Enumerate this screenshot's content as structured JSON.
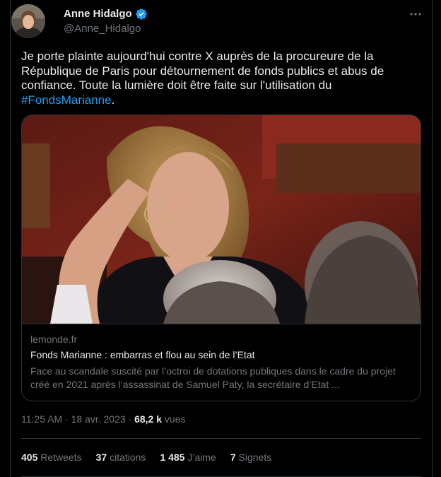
{
  "author": {
    "display_name": "Anne Hidalgo",
    "handle": "@Anne_Hidalgo",
    "verified": true,
    "verified_color": "#1d9bf0"
  },
  "tweet": {
    "text_before": "Je porte plainte aujourd'hui contre X auprès de la procureure de la République de Paris pour détournement de fonds publics et abus de confiance. Toute la lumière doit être faite sur l'utilisation du ",
    "hashtag": "#FondsMarianne",
    "text_after": "."
  },
  "card": {
    "domain": "lemonde.fr",
    "title": "Fonds Marianne : embarras et flou au sein de l’Etat",
    "description": "Face au scandale suscité par l’octroi de dotations publiques dans le cadre du projet créé en 2021 après l’assassinat de Samuel Paty, la secrétaire d’Etat ..."
  },
  "meta": {
    "time": "11:25 AM",
    "separator": " · ",
    "date": "18 avr. 2023",
    "views_count": "68,2 k",
    "views_label": "vues"
  },
  "stats": [
    {
      "count": "405",
      "label": "Retweets"
    },
    {
      "count": "37",
      "label": "citations"
    },
    {
      "count": "1 485",
      "label": "J’aime"
    },
    {
      "count": "7",
      "label": "Signets"
    }
  ],
  "icons": {
    "more": "more-horizontal-icon",
    "verified": "verified-badge-icon"
  },
  "colors": {
    "background": "#000000",
    "text": "#e7e9ea",
    "secondary": "#71767b",
    "link": "#1d9bf0",
    "border": "#2f3336"
  }
}
